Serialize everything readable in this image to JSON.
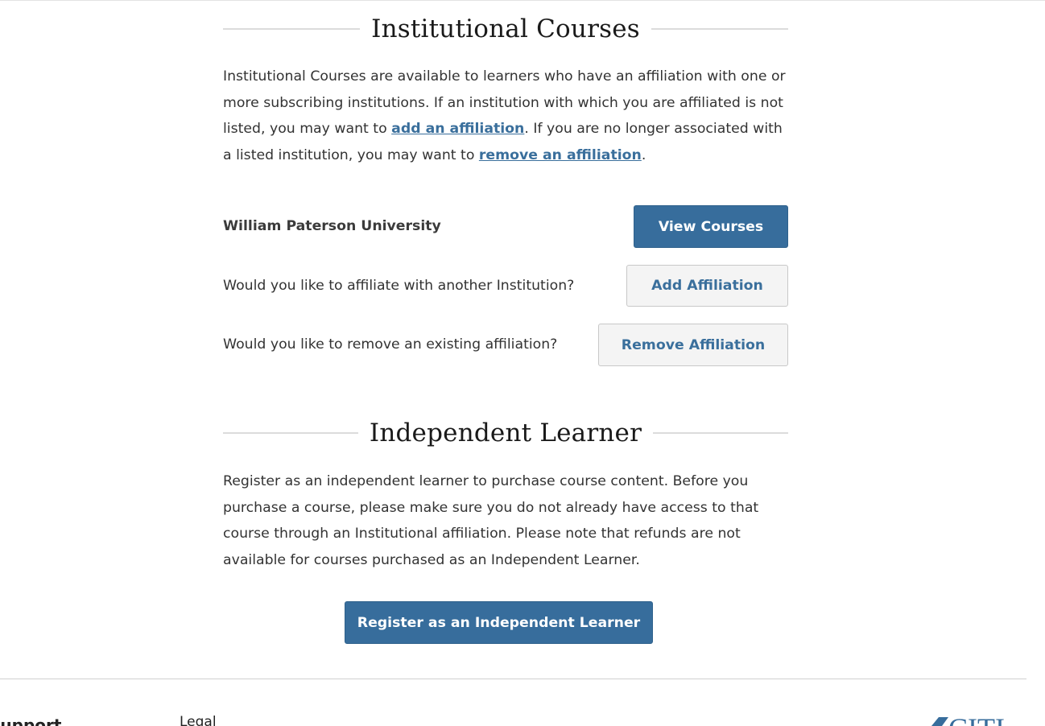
{
  "institutional": {
    "heading": "Institutional Courses",
    "intro_part1": "Institutional Courses are available to learners who have an affiliation with one or more subscribing institutions. If an institution with which you are affiliated is not listed, you may want to ",
    "add_link": "add an affiliation",
    "intro_part2": ". If you are no longer associated with a listed institution, you may want to ",
    "remove_link": "remove an affiliation",
    "intro_part3": ".",
    "institution_name": "William Paterson University",
    "view_courses_label": "View Courses",
    "add_question": "Would you like to affiliate with another Institution?",
    "add_button_label": "Add Affiliation",
    "remove_question": "Would you like to remove an existing affiliation?",
    "remove_button_label": "Remove Affiliation"
  },
  "independent": {
    "heading": "Independent Learner",
    "description": "Register as an independent learner to purchase course content. Before you purchase a course, please make sure you do not already have access to that course through an Institutional affiliation. Please note that refunds are not available for courses purchased as an Independent Learner.",
    "register_button_label": "Register as an Independent Learner"
  },
  "footer": {
    "support_heading": "Support",
    "legal_heading": "Legal",
    "logo_text": "CITI"
  },
  "colors": {
    "primary": "#376d9c",
    "link": "#3a6f9c",
    "secondary_bg": "#f4f4f4"
  }
}
